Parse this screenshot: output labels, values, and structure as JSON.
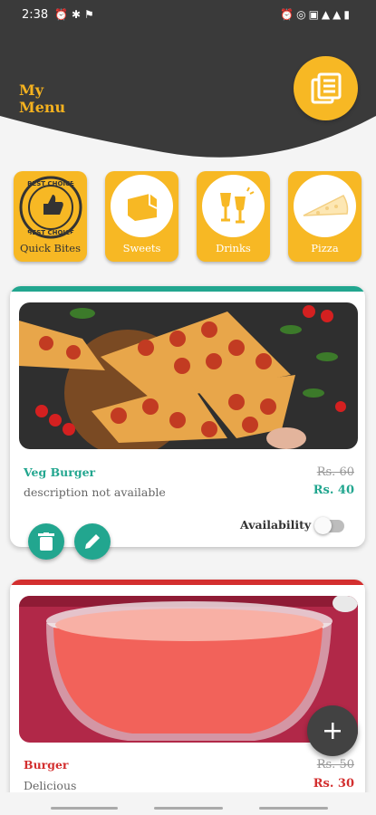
{
  "status_bar": {
    "time": "2:38",
    "left_icons": [
      "alarm-icon",
      "bug-icon",
      "person-walk-icon"
    ],
    "right_icons": [
      "alarm-clock-icon",
      "hotspot-icon",
      "volte-icon",
      "lte-signal-icon",
      "signal-icon",
      "battery-icon"
    ]
  },
  "header": {
    "title": "My\nMenu",
    "menu_icon": "menu-list-icon"
  },
  "categories": [
    {
      "label": "Quick Bites",
      "icon": "best-choice-badge-icon"
    },
    {
      "label": "Sweets",
      "icon": "sweets-icon"
    },
    {
      "label": "Drinks",
      "icon": "drinks-icon"
    },
    {
      "label": "Pizza",
      "icon": "pizza-icon"
    }
  ],
  "items": [
    {
      "name": "Veg Burger",
      "description": "description not available",
      "old_price": "Rs. 60",
      "new_price": "Rs. 40",
      "availability_label": "Availability",
      "available": false,
      "accent": "#22a68f",
      "image": "pizza-image"
    },
    {
      "name": "Burger",
      "description": "Delicious",
      "old_price": "Rs. 50",
      "new_price": "Rs. 30",
      "accent": "#d32f2f",
      "image": "drink-bowl-image"
    }
  ],
  "colors": {
    "header_bg": "#3a3a3a",
    "brand_yellow": "#f7b824",
    "teal": "#22a68f",
    "red": "#d32f2f"
  },
  "fab": {
    "icon": "plus-icon"
  }
}
